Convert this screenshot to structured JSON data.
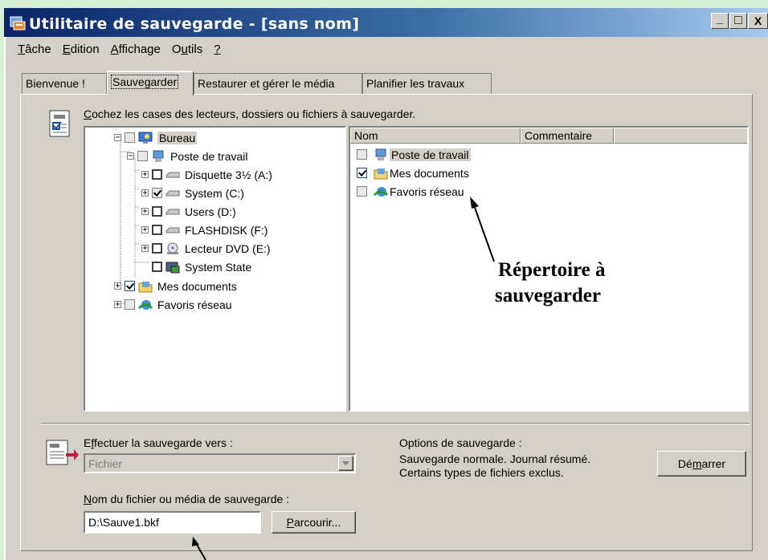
{
  "window": {
    "title": "Utilitaire de sauvegarde - [sans nom]",
    "controls": [
      "_",
      "□",
      "X"
    ]
  },
  "menu": [
    {
      "key": "T",
      "rest": "âche"
    },
    {
      "key": "E",
      "rest": "dition"
    },
    {
      "key": "A",
      "rest": "ffichage"
    },
    {
      "pre": "O",
      "key": "u",
      "rest": "tils"
    },
    {
      "key": "?",
      "rest": ""
    }
  ],
  "tabs": [
    "Bienvenue !",
    "Sauvegarder",
    "Restaurer et gérer le média",
    "Planifier les travaux"
  ],
  "active_tab": "Sauvegarder",
  "instruction": {
    "key": "C",
    "rest": "ochez les cases des lecteurs, dossiers ou fichiers à sauvegarder."
  },
  "tree": [
    {
      "label": "Bureau",
      "check": "gray",
      "icon": "desktop-icon"
    },
    {
      "label": "Poste de travail",
      "check": "gray",
      "icon": "computer-icon"
    },
    {
      "label": "Disquette 3½ (A:)",
      "check": "none",
      "icon": "floppy-icon"
    },
    {
      "label": "System (C:)",
      "check": "checked-gray",
      "icon": "drive-icon"
    },
    {
      "label": "Users (D:)",
      "check": "none",
      "icon": "drive-icon"
    },
    {
      "label": "FLASHDISK (F:)",
      "check": "none",
      "icon": "drive-icon"
    },
    {
      "label": "Lecteur DVD (E:)",
      "check": "none",
      "icon": "dvd-icon"
    },
    {
      "label": "System State",
      "check": "none",
      "icon": "system-state-icon"
    },
    {
      "label": "Mes documents",
      "check": "checked",
      "icon": "documents-icon"
    },
    {
      "label": "Favoris réseau",
      "check": "gray",
      "icon": "network-icon"
    }
  ],
  "list": {
    "columns": [
      "Nom",
      "Commentaire"
    ],
    "items": [
      {
        "label": "Poste de travail",
        "check": "gray",
        "icon": "computer-icon"
      },
      {
        "label": "Mes documents",
        "check": "checked",
        "icon": "documents-icon"
      },
      {
        "label": "Favoris réseau",
        "check": "gray",
        "icon": "network-icon"
      }
    ]
  },
  "annotation": {
    "line1": "Répertoire à",
    "line2": "sauvegarder"
  },
  "destination": {
    "label_key": "f",
    "label_pre": "E",
    "label_rest": "fectuer la sauvegarde vers :",
    "value": "Fichier"
  },
  "filename": {
    "label_key": "N",
    "label_rest": "om du fichier ou média de sauvegarde :",
    "value": "D:\\Sauve1.bkf"
  },
  "browse_button": {
    "key": "P",
    "rest": "arcourir..."
  },
  "options": {
    "title": "Options de sauvegarde :",
    "text": "Sauvegarde normale.  Journal résumé.  Certains types de fichiers exclus."
  },
  "start_button": {
    "pre": "Dé",
    "key": "m",
    "rest": "arrer"
  },
  "colors": {
    "title_start": "#0a246a",
    "title_end": "#a6caf0",
    "face": "#d4d0c8",
    "background": "#d8efd5"
  }
}
